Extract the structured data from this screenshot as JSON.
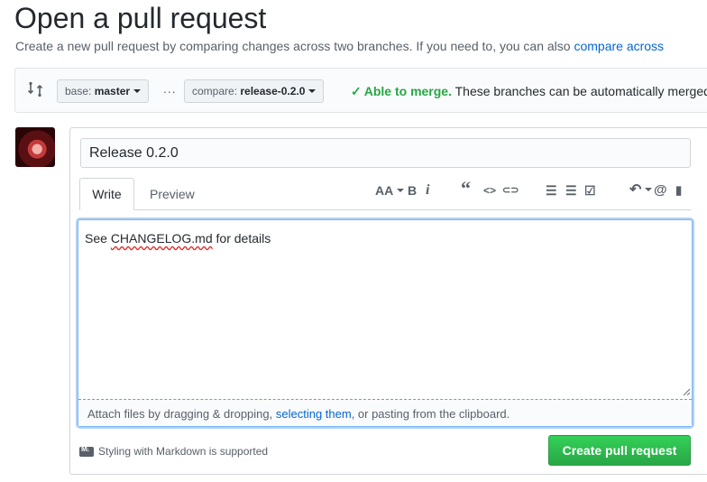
{
  "header": {
    "title": "Open a pull request",
    "subtitle": "Create a new pull request by comparing changes across two branches. If you need to, you can also",
    "subtitle_link": "compare across"
  },
  "range": {
    "base_label": "base:",
    "base_value": "master",
    "ellipsis": "...",
    "compare_label": "compare:",
    "compare_value": "release-0.2.0",
    "merge_status": "Able to merge.",
    "merge_detail": "These branches can be automatically merged."
  },
  "form": {
    "title_value": "Release 0.2.0",
    "tabs": [
      "Write",
      "Preview"
    ],
    "body_prefix": "See ",
    "body_word": "CHANGELOG.md",
    "body_suffix": " for details",
    "attach_prefix": "Attach files by dragging & dropping, ",
    "attach_link": "selecting them",
    "attach_suffix": ", or pasting from the clipboard.",
    "markdown_note": "Styling with Markdown is supported",
    "submit_label": "Create pull request"
  },
  "toolbar": {
    "header": "AA",
    "bold": "B",
    "italic": "i",
    "quote": "“",
    "code": "<>",
    "link": "⊂⊃",
    "ul": "☰",
    "ol": "☰",
    "task": "☑",
    "reply": "↶",
    "mention": "@",
    "ref": "▮"
  },
  "colors": {
    "accent": "#0366d6",
    "success": "#28a745"
  }
}
